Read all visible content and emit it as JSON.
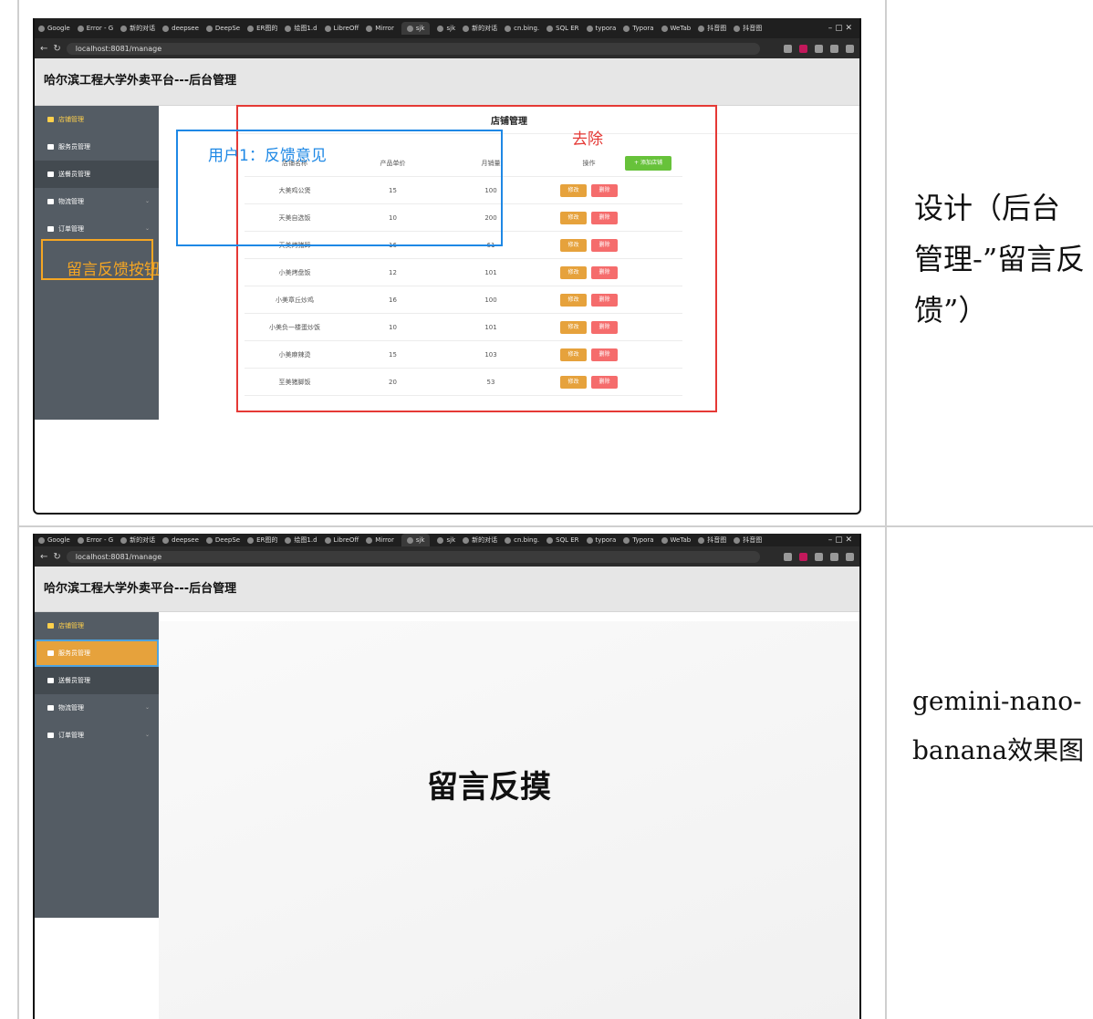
{
  "browser": {
    "tabs": [
      "Google",
      "Error - G",
      "新的对话",
      "deepsee",
      "DeepSe",
      "ER图的",
      "绘图1.d",
      "LibreOff",
      "Mirror",
      "sjk",
      "sjk",
      "新的对话",
      "cn.bing.",
      "SQL ER",
      "typora",
      "Typora",
      "WeTab",
      "抖音图",
      "抖音图"
    ],
    "url": "localhost:8081/manage"
  },
  "app": {
    "header_title": "哈尔滨工程大学外卖平台---后台管理",
    "menu": [
      "店铺管理",
      "服务员管理",
      "送餐员管理",
      "物流管理",
      "订单管理"
    ]
  },
  "store_page": {
    "title": "店铺管理",
    "columns": [
      "店铺名称",
      "产品单价",
      "月销量",
      "操作"
    ],
    "add_button": "+ 添加店铺",
    "edit_label": "修改",
    "delete_label": "删除",
    "rows": [
      [
        "大美鸡公煲",
        "15",
        "100"
      ],
      [
        "天美自选饭",
        "10",
        "200"
      ],
      [
        "天美烤猪蹄",
        "16",
        "61"
      ],
      [
        "小美烤盘饭",
        "12",
        "101"
      ],
      [
        "小美章丘炒鸡",
        "16",
        "100"
      ],
      [
        "小美负一楼蛋炒饭",
        "10",
        "101"
      ],
      [
        "小美麻辣烫",
        "15",
        "103"
      ],
      [
        "至美猪脚饭",
        "20",
        "53"
      ]
    ]
  },
  "annotations": {
    "remove": "去除",
    "user_feedback": "用户1：反馈意见",
    "feedback_button": "留言反馈按钮",
    "colors": {
      "red": "#e53935",
      "blue": "#1e88e5",
      "yellow": "#f5a623"
    }
  },
  "result_page": {
    "center_text": "留言反摸"
  },
  "captions": {
    "top": "设计（后台管理-”留言反馈”）",
    "bottom": "gemini-nano-banana效果图"
  }
}
